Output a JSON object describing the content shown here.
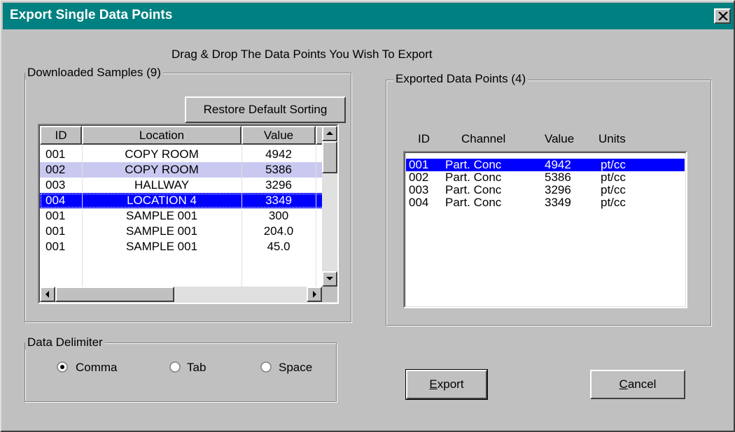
{
  "window": {
    "title": "Export Single Data Points",
    "instruction": "Drag & Drop The Data Points You Wish To Export"
  },
  "downloaded": {
    "group_label": "Downloaded Samples (9)",
    "restore_button": "Restore Default Sorting",
    "columns": [
      "ID",
      "Location",
      "Value"
    ],
    "rows": [
      {
        "id": "001",
        "location": "COPY ROOM",
        "value": "4942"
      },
      {
        "id": "002",
        "location": "COPY ROOM",
        "value": "5386"
      },
      {
        "id": "003",
        "location": "HALLWAY",
        "value": "3296"
      },
      {
        "id": "004",
        "location": "LOCATION 4",
        "value": "3349"
      },
      {
        "id": "001",
        "location": "SAMPLE 001",
        "value": "300"
      },
      {
        "id": "001",
        "location": "SAMPLE 001",
        "value": "204.0"
      },
      {
        "id": "001",
        "location": "SAMPLE 001",
        "value": "45.0"
      }
    ]
  },
  "exported": {
    "group_label": "Exported Data Points (4)",
    "columns": [
      "ID",
      "Channel",
      "Value",
      "Units"
    ],
    "rows": [
      {
        "id": "001",
        "channel": "Part. Conc",
        "value": "4942",
        "units": "pt/cc"
      },
      {
        "id": "002",
        "channel": "Part. Conc",
        "value": "5386",
        "units": "pt/cc"
      },
      {
        "id": "003",
        "channel": "Part. Conc",
        "value": "3296",
        "units": "pt/cc"
      },
      {
        "id": "004",
        "channel": "Part. Conc",
        "value": "3349",
        "units": "pt/cc"
      }
    ]
  },
  "delimiter": {
    "group_label": "Data Delimiter",
    "options": [
      {
        "label": "Comma",
        "selected": true
      },
      {
        "label": "Tab",
        "selected": false
      },
      {
        "label": "Space",
        "selected": false
      }
    ]
  },
  "buttons": {
    "export_mnemonic": "E",
    "export_rest": "xport",
    "cancel_mnemonic": "C",
    "cancel_rest": "ancel"
  },
  "colors": {
    "titlebar": "#008080",
    "selection": "#0000ff",
    "selection_light": "#c8c8f0",
    "face": "#c0c0c0"
  },
  "icons": {
    "close": "close-icon",
    "scroll_up": "arrow-up-icon",
    "scroll_down": "arrow-down-icon",
    "scroll_left": "arrow-left-icon",
    "scroll_right": "arrow-right-icon"
  }
}
